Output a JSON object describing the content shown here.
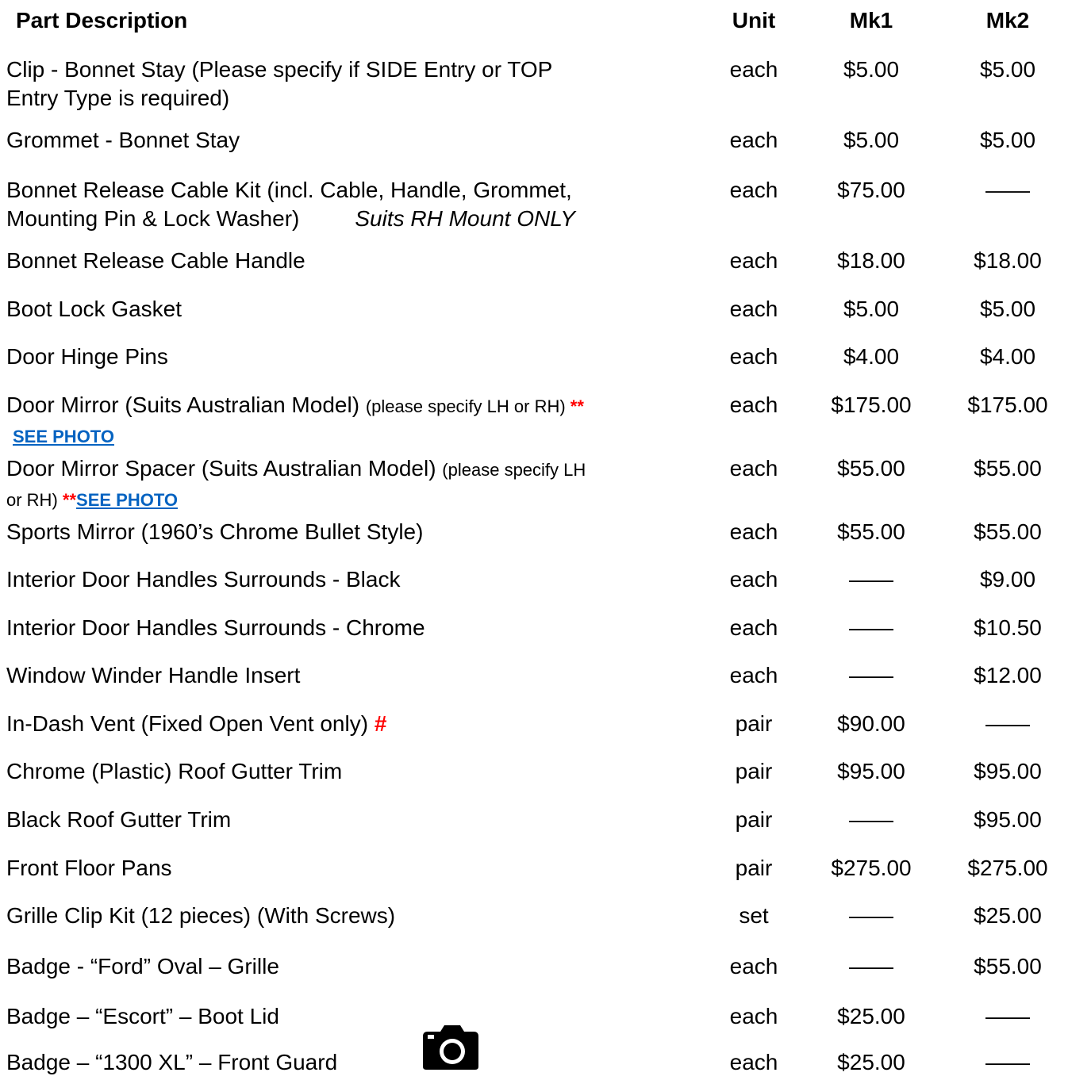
{
  "header": {
    "description": "Part Description",
    "unit": "Unit",
    "mk1": "Mk1",
    "mk2": "Mk2"
  },
  "rows": [
    {
      "d": " Clip - Bonnet Stay (Please specify if SIDE Entry or TOP",
      "d2": "Entry Type is required)",
      "unit": "each",
      "mk1": "$5.00",
      "mk2": "$5.00"
    },
    {
      "d": " Grommet - Bonnet Stay",
      "unit": "each",
      "mk1": "$5.00",
      "mk2": "$5.00"
    },
    {
      "d": " Bonnet Release Cable Kit (incl. Cable, Handle, Grommet,",
      "d2": "Mounting Pin & Lock Washer)",
      "note": "Suits RH Mount ONLY",
      "unit": "each",
      "mk1": "$75.00",
      "mk2": "——"
    },
    {
      "d": " Bonnet Release Cable Handle",
      "unit": "each",
      "mk1": "$18.00",
      "mk2": "$18.00"
    },
    {
      "d": " Boot Lock Gasket",
      "unit": "each",
      "mk1": "$5.00",
      "mk2": "$5.00"
    },
    {
      "d": " Door Hinge Pins",
      "unit": "each",
      "mk1": "$4.00",
      "mk2": "$4.00"
    },
    {
      "d": " Door Mirror (Suits Australian Model) ",
      "small": "(please specify LH or RH) ",
      "red": "**",
      "link": "SEE PHOTO",
      "unit": "each",
      "mk1": "$175.00",
      "mk2": "$175.00"
    },
    {
      "d": " Door Mirror Spacer (Suits Australian Model) ",
      "small": "(please specify LH",
      "small2": "or RH) ",
      "red": "**",
      "link": "SEE PHOTO",
      "unit": "each",
      "mk1": "$55.00",
      "mk2": "$55.00"
    },
    {
      "d": " Sports Mirror (1960’s Chrome Bullet Style)",
      "unit": "each",
      "mk1": "$55.00",
      "mk2": "$55.00"
    },
    {
      "d": " Interior Door Handles Surrounds - Black",
      "unit": "each",
      "mk1": "——",
      "mk2": "$9.00"
    },
    {
      "d": " Interior Door Handles Surrounds - Chrome",
      "unit": "each",
      "mk1": "——",
      "mk2": "$10.50"
    },
    {
      "d": " Window Winder Handle Insert",
      "unit": "each",
      "mk1": "——",
      "mk2": "$12.00"
    },
    {
      "d": " In-Dash Vent (Fixed Open Vent only) ",
      "red": "#",
      "unit": "pair",
      "mk1": "$90.00",
      "mk2": "——"
    },
    {
      "d": " Chrome (Plastic) Roof Gutter Trim",
      "unit": "pair",
      "mk1": "$95.00",
      "mk2": "$95.00"
    },
    {
      "d": " Black Roof Gutter Trim",
      "unit": "pair",
      "mk1": "——",
      "mk2": "$95.00"
    },
    {
      "d": " Front Floor Pans",
      "unit": "pair",
      "mk1": "$275.00",
      "mk2": "$275.00"
    },
    {
      "d": " Grille Clip Kit (12 pieces) (With Screws)",
      "unit": "set",
      "mk1": "——",
      "mk2": "$25.00"
    },
    {
      "d": " Badge - “Ford” Oval – Grille",
      "unit": "each",
      "mk1": "——",
      "mk2": "$55.00"
    },
    {
      "d": " Badge – “Escort” – Boot Lid",
      "unit": "each",
      "mk1": "$25.00",
      "mk2": "——"
    },
    {
      "d": " Badge – “1300 XL” – Front Guard",
      "unit": "each",
      "mk1": "$25.00",
      "mk2": "——"
    }
  ],
  "icons": {
    "photo": "camera-icon"
  }
}
